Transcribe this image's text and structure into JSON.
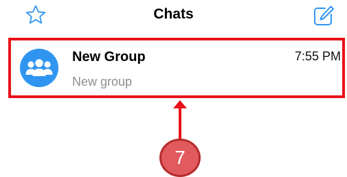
{
  "nav": {
    "title": "Chats",
    "left_icon": "star-icon",
    "right_icon": "compose-icon"
  },
  "chat_list": [
    {
      "name": "New Group",
      "time": "7:55 PM",
      "preview": "New group",
      "avatar_icon": "group-icon",
      "avatar_color": "#2F95F0"
    }
  ],
  "annotation": {
    "step_number": "7",
    "highlight_color": "#E8121B",
    "badge_color": "#E05A5E"
  },
  "colors": {
    "accent": "#2F95F0"
  }
}
